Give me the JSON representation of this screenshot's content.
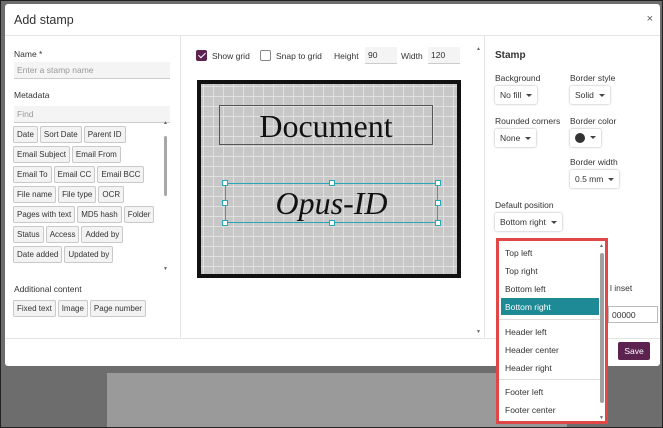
{
  "dialog": {
    "title": "Add stamp",
    "close_glyph": "×",
    "save_label": "Save"
  },
  "left": {
    "name_label": "Name *",
    "name_placeholder": "Enter a stamp name",
    "metadata_label": "Metadata",
    "find_placeholder": "Find",
    "metadata_tags": [
      "Date",
      "Sort Date",
      "Parent ID",
      "Email Subject",
      "Email From",
      "Email To",
      "Email CC",
      "Email BCC",
      "File name",
      "File type",
      "OCR",
      "Pages with text",
      "MD5 hash",
      "Folder",
      "Status",
      "Access",
      "Added by",
      "Date added",
      "Updated by"
    ],
    "additional_label": "Additional content",
    "additional_tags": [
      "Fixed text",
      "Image",
      "Page number"
    ]
  },
  "toolbar": {
    "show_grid_label": "Show grid",
    "show_grid_checked": true,
    "snap_label": "Snap to grid",
    "snap_checked": false,
    "height_label": "Height",
    "height_value": "90",
    "width_label": "Width",
    "width_value": "120"
  },
  "canvas": {
    "document_text": "Document",
    "opus_text": "Opus-ID"
  },
  "stamp": {
    "heading": "Stamp",
    "background_label": "Background",
    "background_value": "No fill",
    "border_style_label": "Border style",
    "border_style_value": "Solid",
    "rounded_label": "Rounded corners",
    "rounded_value": "None",
    "border_color_label": "Border color",
    "border_color": "#333333",
    "border_width_label": "Border width",
    "border_width_value": "0.5 mm",
    "default_position_label": "Default position",
    "default_position_value": "Bottom right",
    "partial_inset_label": "l inset",
    "partial_inset_value": "00000"
  },
  "dropdown": {
    "items": [
      "Top left",
      "Top right",
      "Bottom left",
      "Bottom right",
      "Header left",
      "Header center",
      "Header right",
      "Footer left",
      "Footer center"
    ],
    "selected": "Bottom right",
    "accent_color": "#1e8a96",
    "highlight_border": "#e04848"
  },
  "colors": {
    "brand": "#5c2250",
    "selection": "#2aa7b7"
  }
}
